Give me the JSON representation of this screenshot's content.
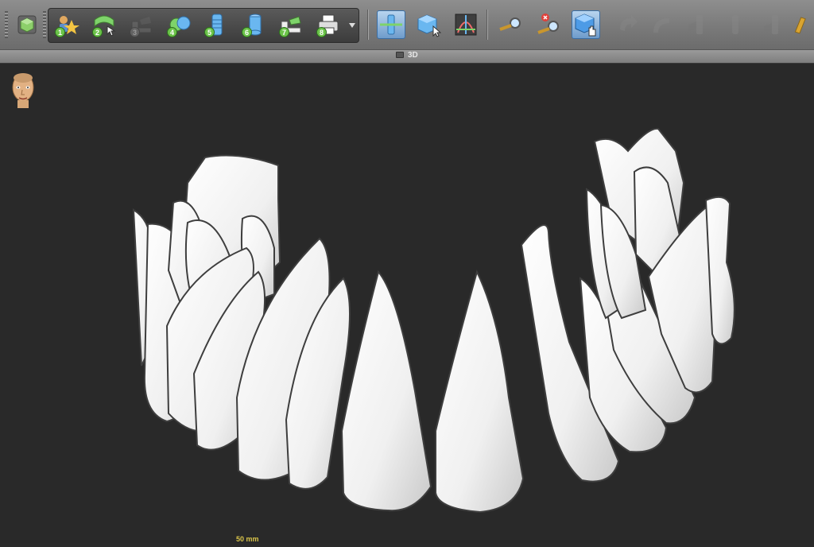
{
  "app": {
    "viewport_title": "3D"
  },
  "toolbar": {
    "workflow_steps": [
      {
        "number": "1",
        "icon": "patient-marker-icon"
      },
      {
        "number": "2",
        "icon": "panoramic-curve-icon"
      },
      {
        "number": "3",
        "icon": "nerve-canal-icon",
        "disabled": true
      },
      {
        "number": "4",
        "icon": "segmentation-icon"
      },
      {
        "number": "5",
        "icon": "implant-icon"
      },
      {
        "number": "6",
        "icon": "abutment-icon"
      },
      {
        "number": "7",
        "icon": "guide-icon"
      },
      {
        "number": "8",
        "icon": "print-icon"
      }
    ]
  },
  "viewport": {
    "scale_label": "50 mm"
  },
  "colors": {
    "accent": "#6f9ccb",
    "step_badge": "#6cc44a",
    "scale_label": "#d9c44a",
    "background": "#292929"
  }
}
